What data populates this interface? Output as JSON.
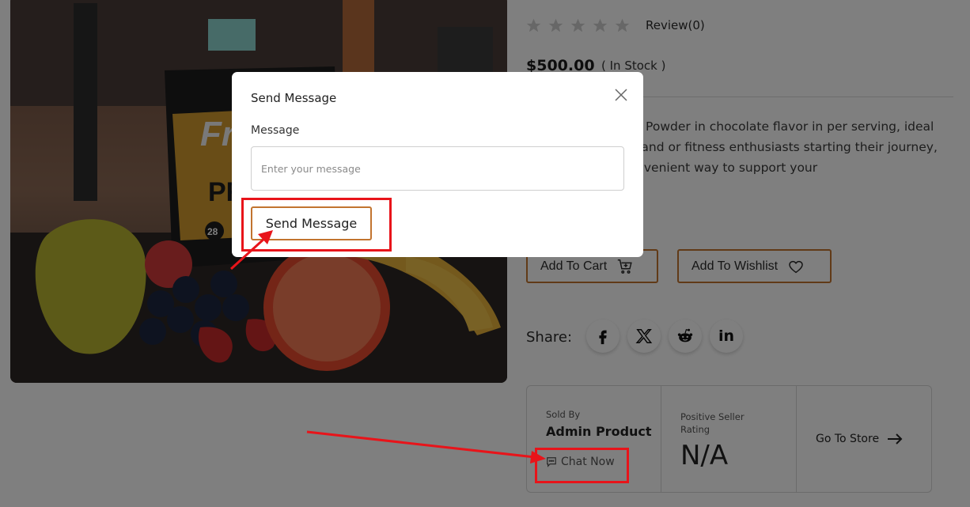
{
  "product": {
    "image_brand_text": "Fr",
    "image_label_text": "PR",
    "image_badge_text": "28",
    "review_count": "Review(0)",
    "rating_stars": 0,
    "rating_max": 5,
    "price": "$500.00",
    "stock_status": "( In Stock )",
    "description": "ner's Whey Protein Powder in chocolate flavor in per serving, ideal for muscle growth and or fitness enthusiasts starting their journey, this licious and convenient way to support your"
  },
  "actions": {
    "add_to_cart": "Add To Cart",
    "add_to_wishlist": "Add To Wishlist"
  },
  "share": {
    "label": "Share:",
    "buttons": [
      "facebook-icon",
      "x-icon",
      "reddit-icon",
      "linkedin-icon"
    ],
    "linkedin_text": "in"
  },
  "seller": {
    "sold_by_label": "Sold By",
    "name": "Admin Product",
    "chat_now": "Chat Now",
    "rating_label": "Positive Seller Rating",
    "rating_value": "N/A",
    "go_to_store": "Go To Store"
  },
  "modal": {
    "title": "Send Message",
    "field_label": "Message",
    "input_value": "",
    "input_placeholder": "Enter your message",
    "submit_label": "Send Message"
  },
  "colors": {
    "accent": "#c2742f",
    "highlight": "#e8141a",
    "overlay": "rgba(0,0,0,0.5)"
  }
}
